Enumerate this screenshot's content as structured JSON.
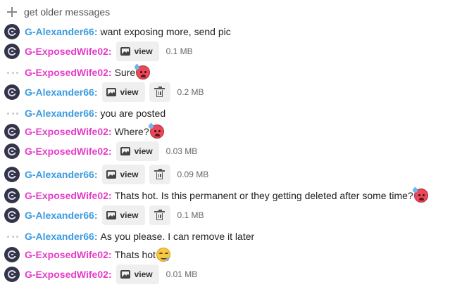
{
  "older_messages_label": "get older messages",
  "users": {
    "alex": "G-Alexander66",
    "wife": "G-ExposedWife02"
  },
  "separator": ":",
  "view_label": "view",
  "messages": [
    {
      "user": "G-Alexander66",
      "text": "want exposing more, send pic"
    },
    {
      "user": "G-ExposedWife02",
      "attachment": "view",
      "size": "0.1 MB"
    },
    {
      "user": "G-ExposedWife02",
      "text": "Sure",
      "emoji": "hot-face-emoji"
    },
    {
      "user": "G-Alexander66",
      "attachment": "view",
      "size": "0.2 MB",
      "deletable": true
    },
    {
      "user": "G-Alexander66",
      "text": "you are posted"
    },
    {
      "user": "G-ExposedWife02",
      "text": "Where?",
      "emoji": "hot-face-emoji"
    },
    {
      "user": "G-ExposedWife02",
      "attachment": "view",
      "size": "0.03 MB"
    },
    {
      "user": "G-Alexander66",
      "attachment": "view",
      "size": "0.09 MB",
      "deletable": true
    },
    {
      "user": "G-ExposedWife02",
      "text": "Thats hot. Is this permanent or they getting deleted after some time?",
      "emoji": "hot-face-emoji"
    },
    {
      "user": "G-Alexander66",
      "attachment": "view",
      "size": "0.1 MB",
      "deletable": true
    },
    {
      "user": "G-Alexander66",
      "text": "As you please. I can remove it later"
    },
    {
      "user": "G-ExposedWife02",
      "text": "Thats hot",
      "emoji": "drooling-face-emoji"
    },
    {
      "user": "G-ExposedWife02",
      "attachment": "view",
      "size": "0.01 MB"
    }
  ],
  "colors": {
    "alex": "#3b9ce0",
    "wife": "#e63cc8",
    "button_bg": "#efefef"
  }
}
